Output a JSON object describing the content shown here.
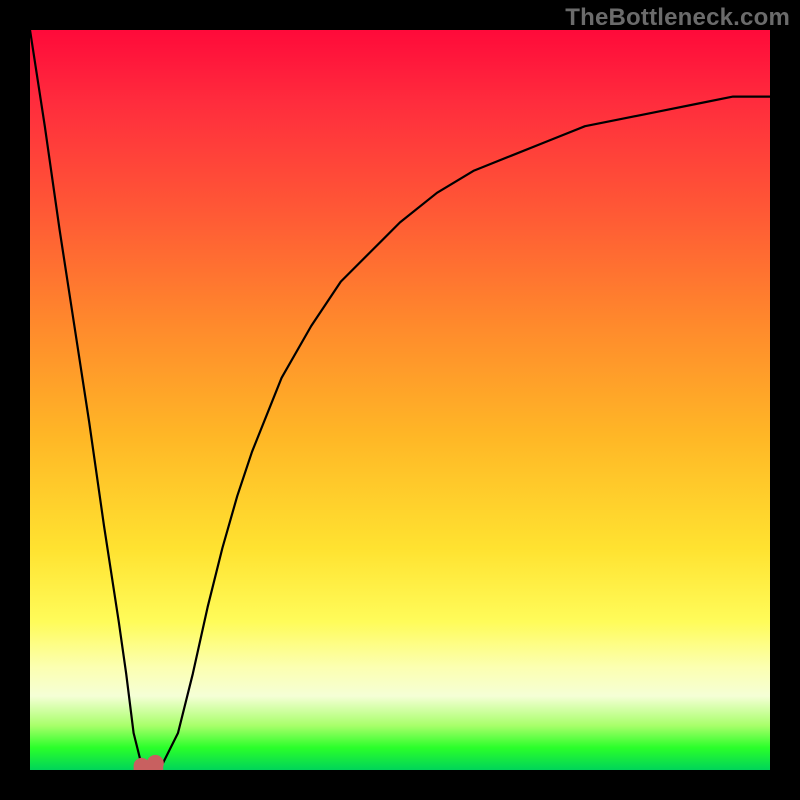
{
  "watermark_text": "TheBottleneck.com",
  "colors": {
    "frame": "#000000",
    "curve": "#000000",
    "marker": "#c86060",
    "gradient_top": "#ff0a3a",
    "gradient_bottom": "#00d45a"
  },
  "chart_data": {
    "type": "line",
    "title": "",
    "xlabel": "",
    "ylabel": "",
    "xlim": [
      0,
      100
    ],
    "ylim": [
      0,
      100
    ],
    "grid": false,
    "legend": false,
    "series": [
      {
        "name": "bottleneck-curve",
        "x": [
          0,
          2,
          4,
          6,
          8,
          10,
          12,
          13,
          14,
          15,
          16,
          17,
          18,
          20,
          22,
          24,
          26,
          28,
          30,
          34,
          38,
          42,
          46,
          50,
          55,
          60,
          65,
          70,
          75,
          80,
          85,
          90,
          95,
          100
        ],
        "y": [
          100,
          87,
          73,
          60,
          47,
          33,
          20,
          13,
          5,
          1,
          0,
          0,
          1,
          5,
          13,
          22,
          30,
          37,
          43,
          53,
          60,
          66,
          70,
          74,
          78,
          81,
          83,
          85,
          87,
          88,
          89,
          90,
          91,
          91
        ]
      }
    ],
    "flat_bottom": {
      "x_start": 14,
      "x_end": 18,
      "y": 0
    },
    "valley_marker": {
      "x_center": 16,
      "y": 0,
      "width_pct": 4
    }
  }
}
